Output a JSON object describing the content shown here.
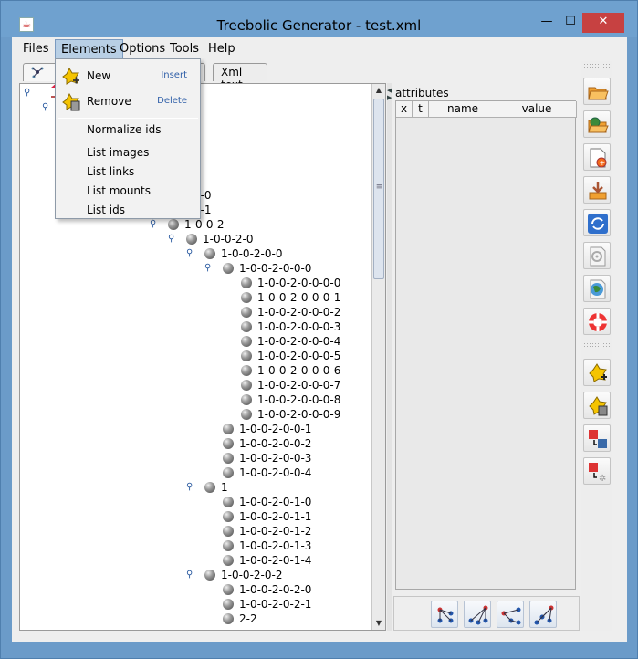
{
  "window": {
    "title": "Treebolic Generator - test.xml",
    "buttons": {
      "minimize": "—",
      "maximize": "☐",
      "close": "✕"
    }
  },
  "menubar": {
    "files": "Files",
    "elements": "Elements",
    "options": "Options",
    "tools": "Tools",
    "help": "Help"
  },
  "tabs": {
    "tree": "",
    "xml": "Xml text"
  },
  "dropdown": {
    "new_label": "New",
    "new_accel": "Insert",
    "remove_label": "Remove",
    "remove_accel": "Delete",
    "normalize": "Normalize ids",
    "list_images": "List images",
    "list_links": "List links",
    "list_mounts": "List mounts",
    "list_ids": "List ids"
  },
  "tree": {
    "nodes": [
      "0-0-0",
      "0-0-1",
      "1-0-0-2",
      "1-0-0-2-0",
      "1-0-0-2-0-0",
      "1-0-0-2-0-0-0",
      "1-0-0-2-0-0-0-0",
      "1-0-0-2-0-0-0-1",
      "1-0-0-2-0-0-0-2",
      "1-0-0-2-0-0-0-3",
      "1-0-0-2-0-0-0-4",
      "1-0-0-2-0-0-0-5",
      "1-0-0-2-0-0-0-6",
      "1-0-0-2-0-0-0-7",
      "1-0-0-2-0-0-0-8",
      "1-0-0-2-0-0-0-9",
      "1-0-0-2-0-0-1",
      "1-0-0-2-0-0-2",
      "1-0-0-2-0-0-3",
      "1-0-0-2-0-0-4",
      "1",
      "1-0-0-2-0-1-0",
      "1-0-0-2-0-1-1",
      "1-0-0-2-0-1-2",
      "1-0-0-2-0-1-3",
      "1-0-0-2-0-1-4",
      "1-0-0-2-0-2",
      "1-0-0-2-0-2-0",
      "1-0-0-2-0-2-1",
      "2-2"
    ]
  },
  "attributes": {
    "title": "attributes",
    "columns": [
      "x",
      "t",
      "name",
      "value"
    ]
  },
  "icons": {
    "tree_toolbar": [
      "tree-layout-1-icon",
      "tree-layout-2-icon",
      "tree-layout-3-icon",
      "tree-layout-4-icon"
    ],
    "right_toolbar": [
      "open-folder-icon",
      "open-url-icon",
      "new-document-icon",
      "import-icon",
      "refresh-icon",
      "settings-document-icon",
      "globe-icon",
      "help-lifebuoy-icon",
      "add-node-icon",
      "remove-node-icon",
      "link-nodes-icon",
      "unlink-nodes-icon"
    ]
  },
  "colors": {
    "titlebar": "#6fa1cf",
    "close": "#c74141",
    "accent": "#2f5fa8"
  }
}
